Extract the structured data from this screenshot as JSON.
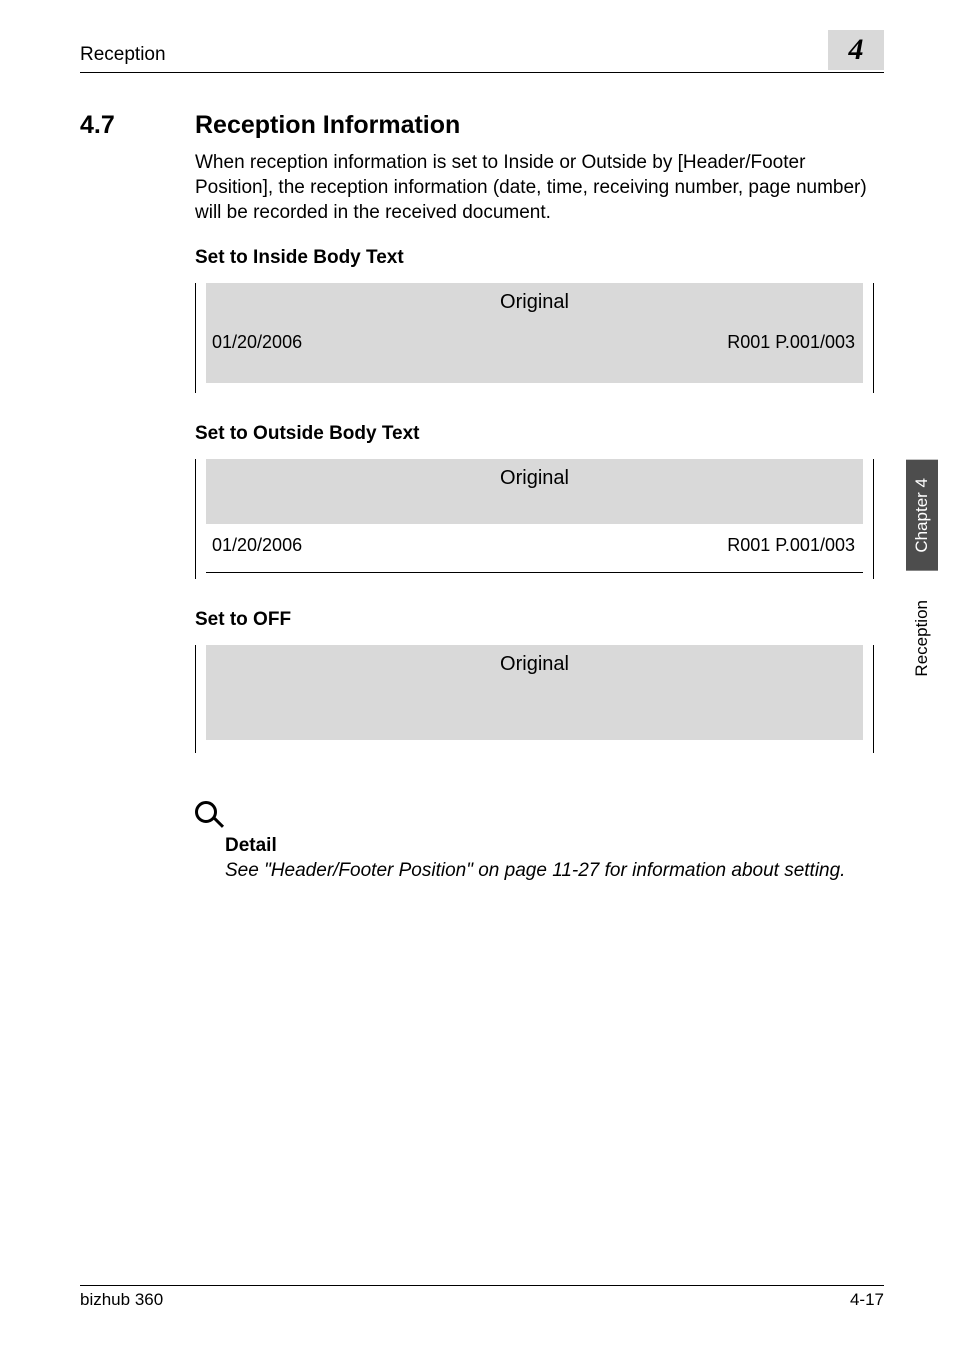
{
  "header": {
    "running_head": "Reception",
    "chapter_badge": "4"
  },
  "section": {
    "number": "4.7",
    "title": "Reception Information",
    "intro": "When reception information is set to Inside or Outside by [Header/Footer Position], the reception information (date, time, receiving number, page number) will be recorded in the received document."
  },
  "subsections": {
    "inside": {
      "heading": "Set to Inside Body Text",
      "title": "Original",
      "date": "01/20/2006",
      "info": "R001 P.001/003"
    },
    "outside": {
      "heading": "Set to Outside Body Text",
      "title": "Original",
      "date": "01/20/2006",
      "info": "R001 P.001/003"
    },
    "off": {
      "heading": "Set to OFF",
      "title": "Original"
    }
  },
  "detail": {
    "heading": "Detail",
    "text": "See \"Header/Footer Position\" on page 11-27 for information about setting."
  },
  "side_tabs": {
    "chapter": "Chapter 4",
    "name": "Reception"
  },
  "footer": {
    "product": "bizhub 360",
    "page": "4-17"
  }
}
